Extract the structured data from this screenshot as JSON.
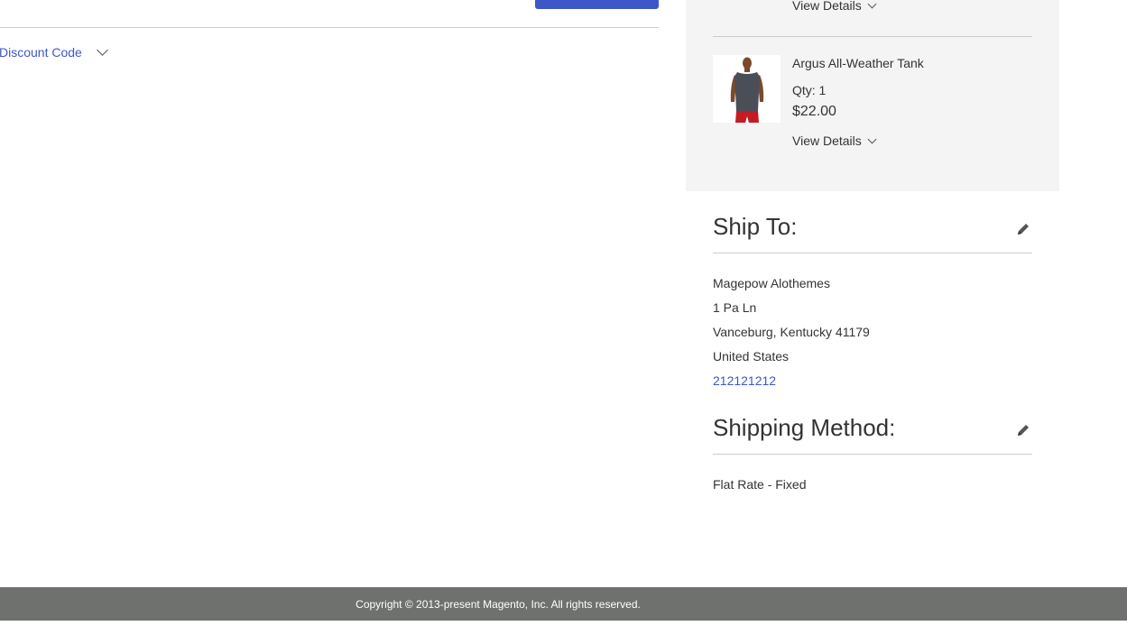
{
  "checkout": {
    "discount": {
      "toggle_label": "Discount Code"
    }
  },
  "summary": {
    "items": [
      {
        "view_details_label": "View Details"
      },
      {
        "name": "Argus All-Weather Tank",
        "qty": "Qty: 1",
        "price": "$22.00",
        "view_details_label": "View Details",
        "image_icon": "product-tank-image"
      }
    ]
  },
  "ship_to": {
    "title": "Ship To:",
    "edit_icon": "pencil-icon",
    "address": {
      "name": "Magepow Alothemes",
      "street": "1 Pa Ln",
      "city_region_zip": "Vanceburg, Kentucky 41179",
      "country": "United States",
      "phone": "212121212"
    }
  },
  "shipping_method": {
    "title": "Shipping Method:",
    "edit_icon": "pencil-icon",
    "value": "Flat Rate - Fixed"
  },
  "footer": {
    "copyright": "Copyright © 2013-present Magento, Inc. All rights reserved."
  },
  "colors": {
    "accent": "#3d57c9",
    "summary_bg": "#f4f4f4",
    "footer_bg": "#6e716e"
  }
}
